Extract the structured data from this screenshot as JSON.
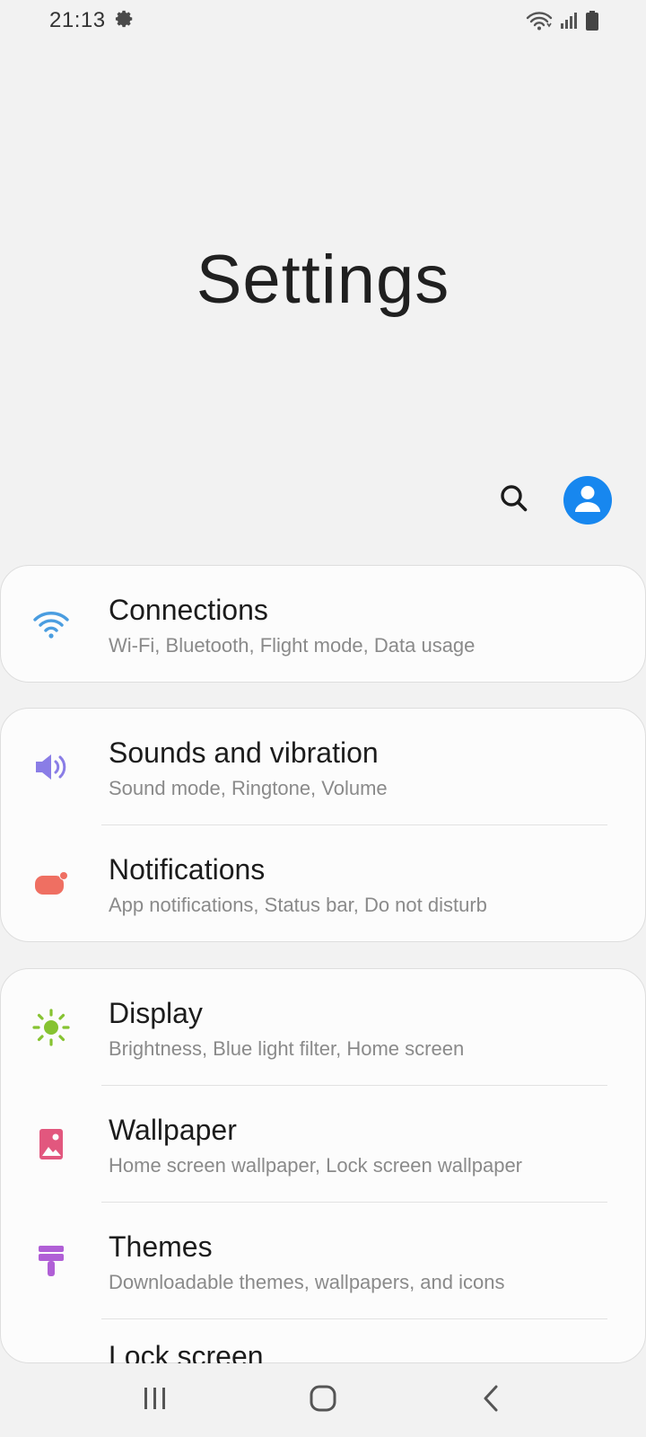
{
  "status_bar": {
    "time": "21:13",
    "icons": [
      "gear-icon",
      "wifi-icon",
      "signal-icon",
      "battery-icon"
    ]
  },
  "header": {
    "title": "Settings"
  },
  "actions": {
    "search_icon": "search-icon",
    "account_icon": "account-icon",
    "accent_color": "#1787ef"
  },
  "items": [
    {
      "title": "Connections",
      "subtitle": "Wi-Fi, Bluetooth, Flight mode, Data usage",
      "icon": "wifi-icon",
      "color": "#4a9de0"
    },
    {
      "title": "Sounds and vibration",
      "subtitle": "Sound mode, Ringtone, Volume",
      "icon": "volume-icon",
      "color": "#8a7de6"
    },
    {
      "title": "Notifications",
      "subtitle": "App notifications, Status bar, Do not disturb",
      "icon": "notification-icon",
      "color": "#ef6f62"
    },
    {
      "title": "Display",
      "subtitle": "Brightness, Blue light filter, Home screen",
      "icon": "sun-icon",
      "color": "#86c331"
    },
    {
      "title": "Wallpaper",
      "subtitle": "Home screen wallpaper, Lock screen wallpaper",
      "icon": "wallpaper-icon",
      "color": "#e2577e"
    },
    {
      "title": "Themes",
      "subtitle": "Downloadable themes, wallpapers, and icons",
      "icon": "brush-icon",
      "color": "#b05fd6"
    },
    {
      "title": "Lock screen",
      "subtitle": "",
      "icon": "lock-icon",
      "color": "#3a9bd9"
    }
  ],
  "nav_bar": {
    "icons": [
      "recents-icon",
      "home-icon",
      "back-icon"
    ]
  }
}
